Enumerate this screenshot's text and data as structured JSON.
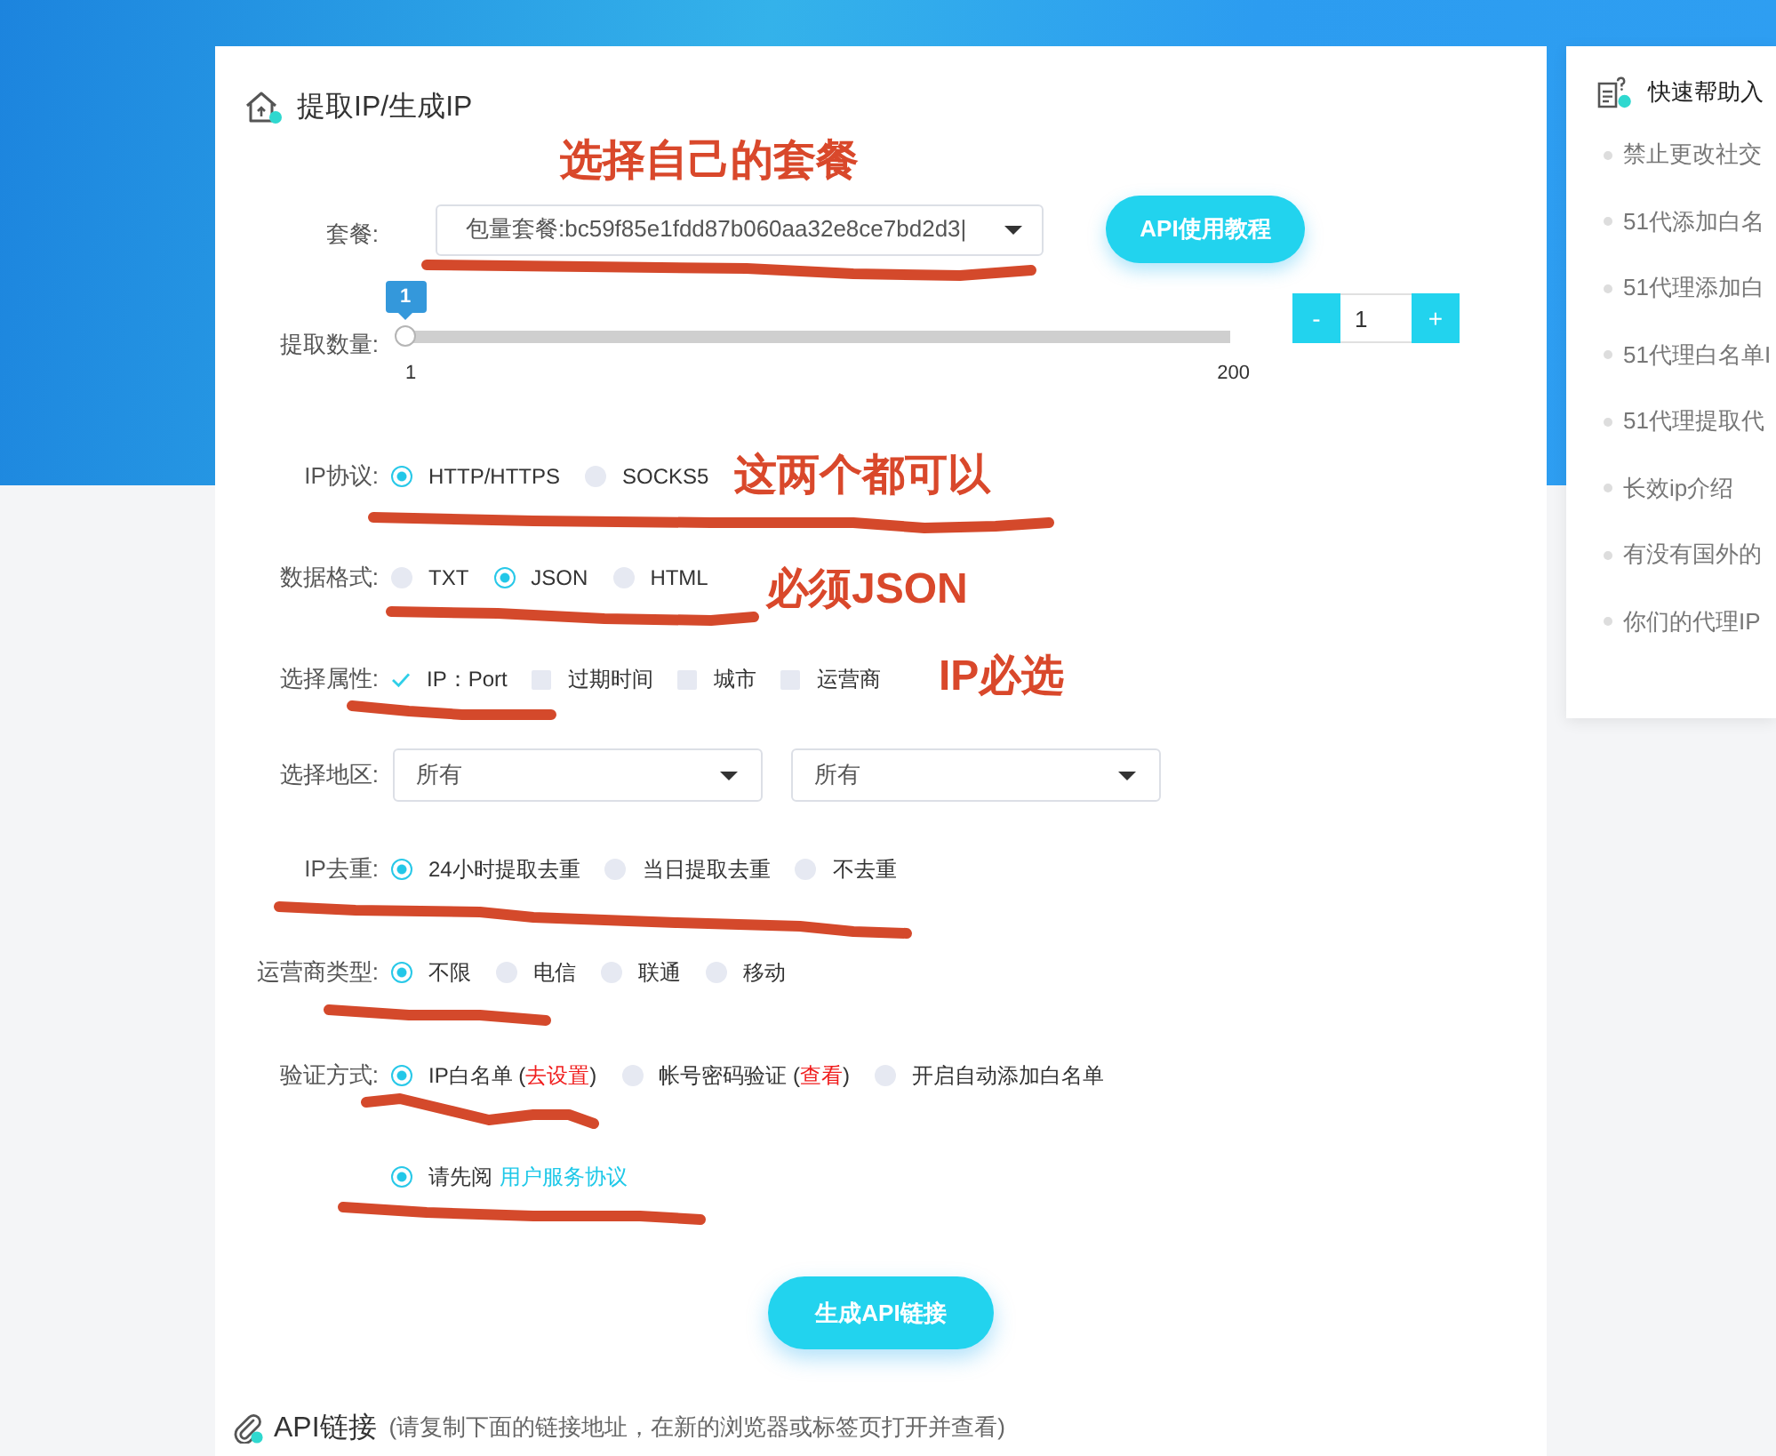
{
  "panel": {
    "title": "提取IP/生成IP"
  },
  "annotations": [
    {
      "text": "选择自己的套餐"
    },
    {
      "text": "这两个都可以"
    },
    {
      "text": "必须JSON"
    },
    {
      "text": "IP必选"
    }
  ],
  "rows": [
    {
      "kind": "select",
      "label": "套餐:",
      "value": "包量套餐:bc59f85e1fdd87b060aa32e8ce7bd2d3|",
      "button": "API使用教程",
      "underlined": true
    },
    {
      "kind": "slider",
      "label": "提取数量:",
      "tooltip": "1",
      "level": 0,
      "min_label": "1",
      "max_label": "200",
      "stepper": {
        "minus": "-",
        "value": "1",
        "plus": "+"
      },
      "underlined": false
    },
    {
      "kind": "radio",
      "label": "IP协议:",
      "options": [
        {
          "text": "HTTP/HTTPS",
          "selected": true
        },
        {
          "text": "SOCKS5",
          "selected": false
        }
      ],
      "underlined": true
    },
    {
      "kind": "radio",
      "label": "数据格式:",
      "options": [
        {
          "text": "TXT",
          "selected": false
        },
        {
          "text": "JSON",
          "selected": true
        },
        {
          "text": "HTML",
          "selected": false
        }
      ],
      "underlined": true
    },
    {
      "kind": "checkbox",
      "label": "选择属性:",
      "options": [
        {
          "text": "IP：Port",
          "checked": true
        },
        {
          "text": "过期时间",
          "checked": false
        },
        {
          "text": "城市",
          "checked": false
        },
        {
          "text": "运营商",
          "checked": false
        }
      ],
      "underlined": true
    },
    {
      "kind": "selects",
      "label": "选择地区:",
      "selects": [
        {
          "value": "所有"
        },
        {
          "value": "所有"
        }
      ],
      "underlined": false
    },
    {
      "kind": "radio",
      "label": "IP去重:",
      "options": [
        {
          "text": "24小时提取去重",
          "selected": true
        },
        {
          "text": "当日提取去重",
          "selected": false
        },
        {
          "text": "不去重",
          "selected": false
        }
      ],
      "underlined": true
    },
    {
      "kind": "radio",
      "label": "运营商类型:",
      "options": [
        {
          "text": "不限",
          "selected": true
        },
        {
          "text": "电信",
          "selected": false
        },
        {
          "text": "联通",
          "selected": false
        },
        {
          "text": "移动",
          "selected": false
        }
      ],
      "underlined": true
    },
    {
      "kind": "radio",
      "label": "验证方式:",
      "options": [
        {
          "text": "IP白名单 (",
          "link": "去设置",
          "after": ")",
          "selected": true
        },
        {
          "text": "帐号密码验证 (",
          "link": "查看",
          "after": ")",
          "selected": false
        },
        {
          "text": "开启自动添加白名单",
          "selected": false
        }
      ],
      "underlined": true
    },
    {
      "kind": "agreement",
      "options": [
        {
          "text": "请先阅",
          "link": "用户服务协议",
          "selected": true
        }
      ],
      "underlined": true
    }
  ],
  "generate_button": "生成API链接",
  "api_link": {
    "title": "API链接",
    "hint": "(请复制下面的链接地址，在新的浏览器或标签页打开并查看)"
  },
  "help": {
    "title": "快速帮助入",
    "items": [
      "禁止更改社交",
      "51代添加白名",
      "51代理添加白",
      "51代理白名单I",
      "51代理提取代",
      "长效ip介绍",
      "有没有国外的",
      "你们的代理IP"
    ]
  }
}
